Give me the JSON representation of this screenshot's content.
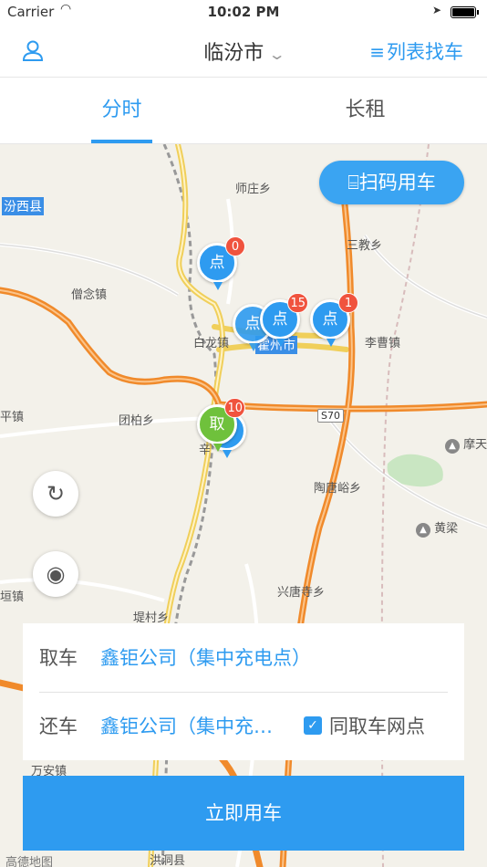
{
  "status_bar": {
    "carrier": "Carrier",
    "time": "10:02 PM"
  },
  "navbar": {
    "city": "临汾市",
    "list_label": "列表找车"
  },
  "tabs": [
    {
      "label": "分时",
      "active": true
    },
    {
      "label": "长租",
      "active": false
    }
  ],
  "map": {
    "scan_button": "扫码用车",
    "labels": {
      "fenxi": "汾西县",
      "shizhuang": "师庄乡",
      "sanjiao": "三教乡",
      "sengnian": "僧念镇",
      "bailong": "白龙镇",
      "licao": "李曹镇",
      "huozhou": "霍州市",
      "pingzhen": "平镇",
      "tuanbai": "团柏乡",
      "motian": "摩天",
      "s70": "S70",
      "xin": "辛",
      "taotang": "陶唐峪乡",
      "huangliang": "黄梁",
      "xingtang": "兴唐寺乡",
      "yuanzhen": "垣镇",
      "dicun": "堤村乡",
      "wanan": "万安镇",
      "hongtong": "洪洞县",
      "amap": "高德地图"
    },
    "pins": [
      {
        "label": "点",
        "count": "0"
      },
      {
        "label": "点",
        "count": "15"
      },
      {
        "label": "点",
        "count": "1"
      },
      {
        "label": "取",
        "count": "10"
      }
    ]
  },
  "booking": {
    "pickup_label": "取车",
    "pickup_value": "鑫钜公司（集中充电点）",
    "return_label": "还车",
    "return_value": "鑫钜公司（集中充…",
    "same_station_label": "同取车网点",
    "same_station_checked": true,
    "submit_label": "立即用车"
  }
}
